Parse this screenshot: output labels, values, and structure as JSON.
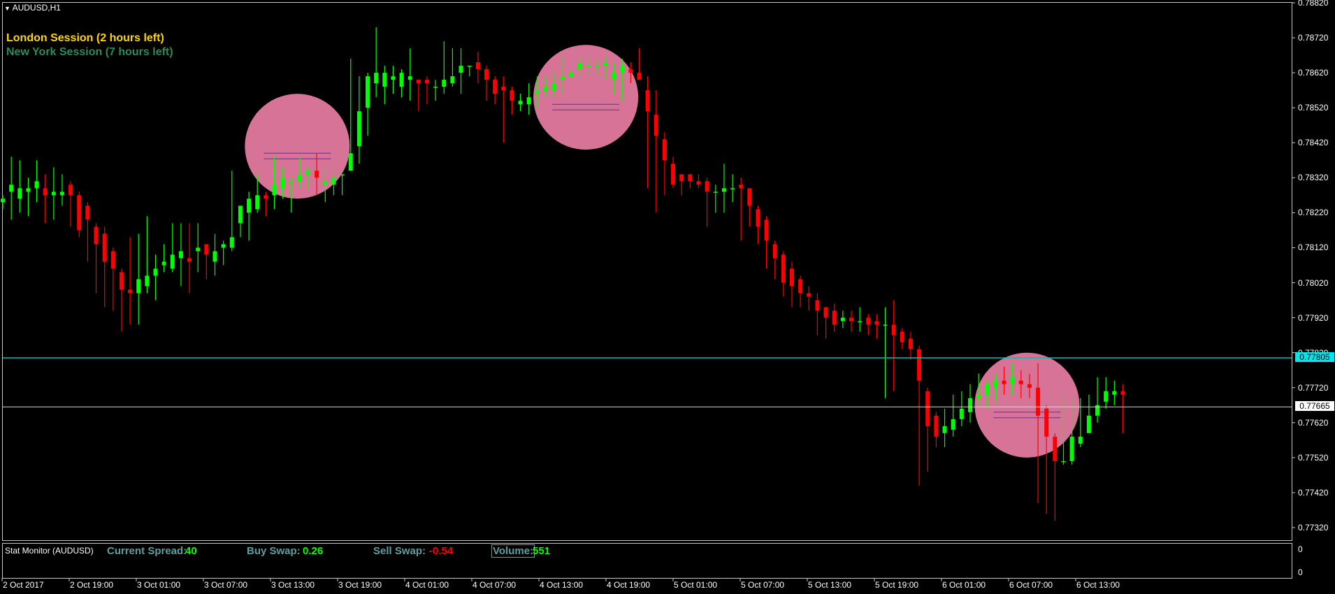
{
  "window": {
    "title": "AUDUSD,H1"
  },
  "sessions": [
    {
      "label": "London Session (2 hours left)",
      "color": "#ffd700"
    },
    {
      "label": "New York Session (7 hours left)",
      "color": "#2e8b57"
    }
  ],
  "price_axis": {
    "labels": [
      "0.78820",
      "0.78720",
      "0.78620",
      "0.78520",
      "0.78420",
      "0.78320",
      "0.78220",
      "0.78120",
      "0.78020",
      "0.77920",
      "0.77820",
      "0.77720",
      "0.77620",
      "0.77520",
      "0.77420",
      "0.77320"
    ],
    "current_price": "0.77805",
    "current_price_color": "#00e5ee",
    "crosshair_price": "0.77665"
  },
  "time_axis": {
    "labels": [
      "2 Oct 2017",
      "2 Oct 19:00",
      "3 Oct 01:00",
      "3 Oct 07:00",
      "3 Oct 13:00",
      "3 Oct 19:00",
      "4 Oct 01:00",
      "4 Oct 07:00",
      "4 Oct 13:00",
      "4 Oct 19:00",
      "5 Oct 01:00",
      "5 Oct 07:00",
      "5 Oct 13:00",
      "5 Oct 19:00",
      "6 Oct 01:00",
      "6 Oct 07:00",
      "6 Oct 13:00"
    ]
  },
  "stat_monitor": {
    "title": "Stat Monitor (AUDUSD)",
    "spread_label": "Current Spread:",
    "spread_value": "40",
    "buy_swap_label": "Buy Swap:",
    "buy_swap_value": "0.26",
    "sell_swap_label": "Sell Swap:",
    "sell_swap_value": "-0.54",
    "volume_label": "Volume:",
    "volume_value": "551"
  },
  "indicator_axis": {
    "labels": [
      "0",
      "0"
    ]
  },
  "colors": {
    "bull": "#00ff00",
    "bear": "#ff0000",
    "highlight": "#f080a8",
    "background": "#000000"
  },
  "chart_data": {
    "type": "candlestick",
    "symbol": "AUDUSD",
    "timeframe": "H1",
    "ylim": [
      0.7732,
      0.7882
    ],
    "candles": [
      {
        "o": 0.7825,
        "h": 0.7827,
        "l": 0.7823,
        "c": 0.7826
      },
      {
        "o": 0.7828,
        "h": 0.7838,
        "l": 0.782,
        "c": 0.783
      },
      {
        "o": 0.7826,
        "h": 0.7837,
        "l": 0.7822,
        "c": 0.7829
      },
      {
        "o": 0.7828,
        "h": 0.7832,
        "l": 0.7821,
        "c": 0.7829
      },
      {
        "o": 0.7829,
        "h": 0.7837,
        "l": 0.7825,
        "c": 0.7831
      },
      {
        "o": 0.7829,
        "h": 0.7833,
        "l": 0.7819,
        "c": 0.7827
      },
      {
        "o": 0.7827,
        "h": 0.7835,
        "l": 0.782,
        "c": 0.7828
      },
      {
        "o": 0.7827,
        "h": 0.7833,
        "l": 0.7824,
        "c": 0.7828
      },
      {
        "o": 0.783,
        "h": 0.7831,
        "l": 0.7818,
        "c": 0.7827
      },
      {
        "o": 0.7827,
        "h": 0.7828,
        "l": 0.7815,
        "c": 0.7817
      },
      {
        "o": 0.7824,
        "h": 0.7825,
        "l": 0.7808,
        "c": 0.782
      },
      {
        "o": 0.7818,
        "h": 0.7819,
        "l": 0.7799,
        "c": 0.7813
      },
      {
        "o": 0.7816,
        "h": 0.7818,
        "l": 0.7795,
        "c": 0.7808
      },
      {
        "o": 0.7811,
        "h": 0.7812,
        "l": 0.7794,
        "c": 0.7806
      },
      {
        "o": 0.7805,
        "h": 0.7806,
        "l": 0.7788,
        "c": 0.78
      },
      {
        "o": 0.78,
        "h": 0.7815,
        "l": 0.779,
        "c": 0.7799
      },
      {
        "o": 0.7799,
        "h": 0.7816,
        "l": 0.779,
        "c": 0.7803
      },
      {
        "o": 0.7801,
        "h": 0.7821,
        "l": 0.7799,
        "c": 0.7804
      },
      {
        "o": 0.7804,
        "h": 0.781,
        "l": 0.7797,
        "c": 0.7806
      },
      {
        "o": 0.7807,
        "h": 0.7813,
        "l": 0.7805,
        "c": 0.7808
      },
      {
        "o": 0.7806,
        "h": 0.7819,
        "l": 0.7805,
        "c": 0.781
      },
      {
        "o": 0.7809,
        "h": 0.7819,
        "l": 0.7801,
        "c": 0.7811
      },
      {
        "o": 0.7809,
        "h": 0.7819,
        "l": 0.7799,
        "c": 0.7808
      },
      {
        "o": 0.7811,
        "h": 0.7819,
        "l": 0.7805,
        "c": 0.7812
      },
      {
        "o": 0.7813,
        "h": 0.7813,
        "l": 0.7803,
        "c": 0.781
      },
      {
        "o": 0.7808,
        "h": 0.7816,
        "l": 0.7804,
        "c": 0.7811
      },
      {
        "o": 0.7812,
        "h": 0.7814,
        "l": 0.7807,
        "c": 0.7813
      },
      {
        "o": 0.7812,
        "h": 0.7834,
        "l": 0.7811,
        "c": 0.7815
      },
      {
        "o": 0.7819,
        "h": 0.7824,
        "l": 0.7815,
        "c": 0.7824
      },
      {
        "o": 0.7822,
        "h": 0.7828,
        "l": 0.7814,
        "c": 0.7826
      },
      {
        "o": 0.7823,
        "h": 0.7833,
        "l": 0.7822,
        "c": 0.7827
      },
      {
        "o": 0.7827,
        "h": 0.7828,
        "l": 0.7821,
        "c": 0.7826
      },
      {
        "o": 0.7827,
        "h": 0.7838,
        "l": 0.7823,
        "c": 0.783
      },
      {
        "o": 0.7829,
        "h": 0.7835,
        "l": 0.7826,
        "c": 0.7832
      },
      {
        "o": 0.7831,
        "h": 0.7832,
        "l": 0.7822,
        "c": 0.7831
      },
      {
        "o": 0.7831,
        "h": 0.7838,
        "l": 0.7829,
        "c": 0.7833
      },
      {
        "o": 0.7833,
        "h": 0.7835,
        "l": 0.7829,
        "c": 0.7834
      },
      {
        "o": 0.7834,
        "h": 0.7839,
        "l": 0.7827,
        "c": 0.7832
      },
      {
        "o": 0.783,
        "h": 0.7835,
        "l": 0.7825,
        "c": 0.7831
      },
      {
        "o": 0.783,
        "h": 0.7835,
        "l": 0.7827,
        "c": 0.7832
      },
      {
        "o": 0.7833,
        "h": 0.7833,
        "l": 0.7827,
        "c": 0.7833
      },
      {
        "o": 0.7834,
        "h": 0.7866,
        "l": 0.7834,
        "c": 0.7839
      },
      {
        "o": 0.7841,
        "h": 0.7861,
        "l": 0.7836,
        "c": 0.7851
      },
      {
        "o": 0.7852,
        "h": 0.7862,
        "l": 0.7844,
        "c": 0.7861
      },
      {
        "o": 0.7859,
        "h": 0.7875,
        "l": 0.7855,
        "c": 0.7862
      },
      {
        "o": 0.7858,
        "h": 0.7864,
        "l": 0.7853,
        "c": 0.7862
      },
      {
        "o": 0.786,
        "h": 0.7864,
        "l": 0.7856,
        "c": 0.7861
      },
      {
        "o": 0.7858,
        "h": 0.7863,
        "l": 0.7855,
        "c": 0.7862
      },
      {
        "o": 0.786,
        "h": 0.7869,
        "l": 0.7854,
        "c": 0.7861
      },
      {
        "o": 0.786,
        "h": 0.786,
        "l": 0.7851,
        "c": 0.7859
      },
      {
        "o": 0.786,
        "h": 0.7861,
        "l": 0.7853,
        "c": 0.7859
      },
      {
        "o": 0.7858,
        "h": 0.786,
        "l": 0.7854,
        "c": 0.7858
      },
      {
        "o": 0.7858,
        "h": 0.7871,
        "l": 0.7856,
        "c": 0.786
      },
      {
        "o": 0.7859,
        "h": 0.7869,
        "l": 0.7858,
        "c": 0.7861
      },
      {
        "o": 0.7862,
        "h": 0.7869,
        "l": 0.7856,
        "c": 0.7864
      },
      {
        "o": 0.7864,
        "h": 0.7864,
        "l": 0.7861,
        "c": 0.7864
      },
      {
        "o": 0.7865,
        "h": 0.7868,
        "l": 0.7859,
        "c": 0.7863
      },
      {
        "o": 0.7863,
        "h": 0.7864,
        "l": 0.7854,
        "c": 0.786
      },
      {
        "o": 0.786,
        "h": 0.7861,
        "l": 0.7853,
        "c": 0.7856
      },
      {
        "o": 0.7858,
        "h": 0.7861,
        "l": 0.7842,
        "c": 0.7857
      },
      {
        "o": 0.7857,
        "h": 0.7858,
        "l": 0.785,
        "c": 0.7854
      },
      {
        "o": 0.7853,
        "h": 0.7856,
        "l": 0.7851,
        "c": 0.7854
      },
      {
        "o": 0.7853,
        "h": 0.7859,
        "l": 0.785,
        "c": 0.7855
      },
      {
        "o": 0.7856,
        "h": 0.7861,
        "l": 0.7852,
        "c": 0.7857
      },
      {
        "o": 0.7857,
        "h": 0.7861,
        "l": 0.7855,
        "c": 0.7858
      },
      {
        "o": 0.7857,
        "h": 0.7862,
        "l": 0.7855,
        "c": 0.7859
      },
      {
        "o": 0.786,
        "h": 0.7867,
        "l": 0.7856,
        "c": 0.7861
      },
      {
        "o": 0.7861,
        "h": 0.7863,
        "l": 0.786,
        "c": 0.7862
      },
      {
        "o": 0.7863,
        "h": 0.7867,
        "l": 0.786,
        "c": 0.7865
      },
      {
        "o": 0.7864,
        "h": 0.7867,
        "l": 0.7861,
        "c": 0.7864
      },
      {
        "o": 0.7864,
        "h": 0.7866,
        "l": 0.7861,
        "c": 0.7864
      },
      {
        "o": 0.7864,
        "h": 0.7867,
        "l": 0.786,
        "c": 0.7865
      },
      {
        "o": 0.786,
        "h": 0.7865,
        "l": 0.7856,
        "c": 0.7862
      },
      {
        "o": 0.7862,
        "h": 0.7866,
        "l": 0.7854,
        "c": 0.7864
      },
      {
        "o": 0.7863,
        "h": 0.7865,
        "l": 0.7859,
        "c": 0.7862
      },
      {
        "o": 0.7862,
        "h": 0.7869,
        "l": 0.786,
        "c": 0.786
      },
      {
        "o": 0.7857,
        "h": 0.7861,
        "l": 0.7829,
        "c": 0.7851
      },
      {
        "o": 0.785,
        "h": 0.7857,
        "l": 0.7822,
        "c": 0.7844
      },
      {
        "o": 0.7843,
        "h": 0.7845,
        "l": 0.7827,
        "c": 0.7837
      },
      {
        "o": 0.7836,
        "h": 0.7838,
        "l": 0.7829,
        "c": 0.783
      },
      {
        "o": 0.7833,
        "h": 0.7833,
        "l": 0.7827,
        "c": 0.7831
      },
      {
        "o": 0.7833,
        "h": 0.7833,
        "l": 0.7829,
        "c": 0.7831
      },
      {
        "o": 0.7831,
        "h": 0.7833,
        "l": 0.7829,
        "c": 0.783
      },
      {
        "o": 0.7831,
        "h": 0.7832,
        "l": 0.7818,
        "c": 0.7828
      },
      {
        "o": 0.7828,
        "h": 0.783,
        "l": 0.7822,
        "c": 0.7828
      },
      {
        "o": 0.7828,
        "h": 0.7836,
        "l": 0.7822,
        "c": 0.7829
      },
      {
        "o": 0.7829,
        "h": 0.7833,
        "l": 0.7825,
        "c": 0.7829
      },
      {
        "o": 0.783,
        "h": 0.7832,
        "l": 0.7814,
        "c": 0.7829
      },
      {
        "o": 0.7829,
        "h": 0.7829,
        "l": 0.7818,
        "c": 0.7824
      },
      {
        "o": 0.7823,
        "h": 0.7824,
        "l": 0.7813,
        "c": 0.7818
      },
      {
        "o": 0.782,
        "h": 0.7821,
        "l": 0.7806,
        "c": 0.7814
      },
      {
        "o": 0.7813,
        "h": 0.7814,
        "l": 0.7803,
        "c": 0.7809
      },
      {
        "o": 0.781,
        "h": 0.7811,
        "l": 0.7798,
        "c": 0.7802
      },
      {
        "o": 0.7806,
        "h": 0.7808,
        "l": 0.7795,
        "c": 0.7801
      },
      {
        "o": 0.7803,
        "h": 0.7804,
        "l": 0.7795,
        "c": 0.7799
      },
      {
        "o": 0.7799,
        "h": 0.7801,
        "l": 0.7794,
        "c": 0.7798
      },
      {
        "o": 0.7797,
        "h": 0.7799,
        "l": 0.7787,
        "c": 0.7794
      },
      {
        "o": 0.7795,
        "h": 0.7795,
        "l": 0.7786,
        "c": 0.7792
      },
      {
        "o": 0.7794,
        "h": 0.7796,
        "l": 0.7788,
        "c": 0.779
      },
      {
        "o": 0.7791,
        "h": 0.7794,
        "l": 0.7789,
        "c": 0.7792
      },
      {
        "o": 0.7792,
        "h": 0.7794,
        "l": 0.7788,
        "c": 0.7791
      },
      {
        "o": 0.7791,
        "h": 0.7795,
        "l": 0.7788,
        "c": 0.7791
      },
      {
        "o": 0.7792,
        "h": 0.7793,
        "l": 0.7787,
        "c": 0.779
      },
      {
        "o": 0.7791,
        "h": 0.7793,
        "l": 0.7786,
        "c": 0.779
      },
      {
        "o": 0.779,
        "h": 0.7795,
        "l": 0.7769,
        "c": 0.779
      },
      {
        "o": 0.779,
        "h": 0.7797,
        "l": 0.7771,
        "c": 0.7787
      },
      {
        "o": 0.7788,
        "h": 0.7789,
        "l": 0.7783,
        "c": 0.7785
      },
      {
        "o": 0.7786,
        "h": 0.7788,
        "l": 0.778,
        "c": 0.7783
      },
      {
        "o": 0.7783,
        "h": 0.7784,
        "l": 0.7744,
        "c": 0.7774
      },
      {
        "o": 0.7771,
        "h": 0.7772,
        "l": 0.7748,
        "c": 0.7761
      },
      {
        "o": 0.7764,
        "h": 0.7765,
        "l": 0.7755,
        "c": 0.7758
      },
      {
        "o": 0.7759,
        "h": 0.7766,
        "l": 0.7755,
        "c": 0.7761
      },
      {
        "o": 0.776,
        "h": 0.777,
        "l": 0.7758,
        "c": 0.7763
      },
      {
        "o": 0.7763,
        "h": 0.7771,
        "l": 0.7761,
        "c": 0.7766
      },
      {
        "o": 0.7765,
        "h": 0.7773,
        "l": 0.7762,
        "c": 0.7769
      },
      {
        "o": 0.7769,
        "h": 0.7776,
        "l": 0.7767,
        "c": 0.777
      },
      {
        "o": 0.777,
        "h": 0.7774,
        "l": 0.7766,
        "c": 0.7773
      },
      {
        "o": 0.7772,
        "h": 0.7776,
        "l": 0.7768,
        "c": 0.7774
      },
      {
        "o": 0.7774,
        "h": 0.7778,
        "l": 0.777,
        "c": 0.7773
      },
      {
        "o": 0.7773,
        "h": 0.7779,
        "l": 0.777,
        "c": 0.7775
      },
      {
        "o": 0.7774,
        "h": 0.7777,
        "l": 0.7769,
        "c": 0.7773
      },
      {
        "o": 0.7773,
        "h": 0.7776,
        "l": 0.7769,
        "c": 0.7772
      },
      {
        "o": 0.7772,
        "h": 0.7779,
        "l": 0.7739,
        "c": 0.7764
      },
      {
        "o": 0.7766,
        "h": 0.7767,
        "l": 0.7736,
        "c": 0.7758
      },
      {
        "o": 0.7758,
        "h": 0.7759,
        "l": 0.7734,
        "c": 0.7751
      },
      {
        "o": 0.7751,
        "h": 0.777,
        "l": 0.775,
        "c": 0.7751
      },
      {
        "o": 0.7751,
        "h": 0.7769,
        "l": 0.775,
        "c": 0.7758
      },
      {
        "o": 0.7756,
        "h": 0.7769,
        "l": 0.7755,
        "c": 0.7758
      },
      {
        "o": 0.7759,
        "h": 0.777,
        "l": 0.7759,
        "c": 0.7764
      },
      {
        "o": 0.7764,
        "h": 0.7775,
        "l": 0.7762,
        "c": 0.7767
      },
      {
        "o": 0.7768,
        "h": 0.7775,
        "l": 0.7766,
        "c": 0.7771
      },
      {
        "o": 0.777,
        "h": 0.7774,
        "l": 0.7767,
        "c": 0.7771
      },
      {
        "o": 0.7771,
        "h": 0.7773,
        "l": 0.7759,
        "c": 0.777
      }
    ],
    "highlights": [
      {
        "label": "",
        "around_candle": 31,
        "price": 0.7839
      },
      {
        "label": "",
        "around_candle": 65,
        "price": 0.7853
      },
      {
        "label": "",
        "around_candle": 117,
        "price": 0.7765
      }
    ]
  }
}
